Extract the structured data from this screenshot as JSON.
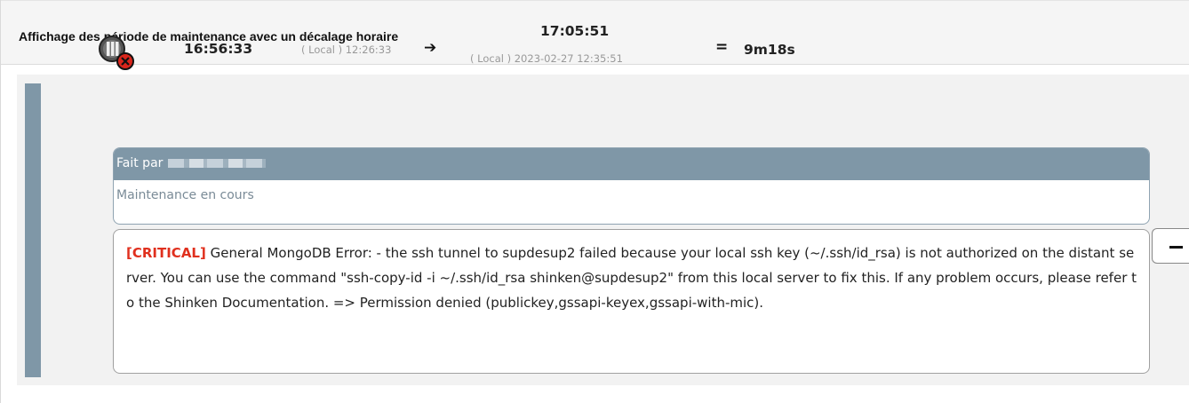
{
  "panel": {
    "title": "Affichage des période de maintenance avec un décalage horaire"
  },
  "maintenance": {
    "status_icon": "maintenance-critical-icon",
    "start_time": "16:56:33",
    "start_local": "( Local ) 12:26:33",
    "arrow_icon": "arrow-right-icon",
    "end_time": "17:05:51",
    "end_local": "( Local ) 2023-02-27 12:35:51",
    "equals": "=",
    "duration": "9m18s",
    "done_by_label": "Fait par",
    "status_text": "Maintenance en cours",
    "output_severity": "[CRITICAL]",
    "output_message": " General MongoDB Error: - the ssh tunnel to supdesup2 failed because your local ssh key (~/.ssh/id_rsa) is not authorized on the distant server. You can use the command \"ssh-copy-id -i ~/.ssh/id_rsa shinken@supdesup2\" from this local server to fix this. If any problem occurs, please refer to the Shinken Documentation. => Permission denied (publickey,gssapi-keyex,gssapi-with-mic).",
    "collapse_icon": "minus-icon"
  },
  "colors": {
    "accent_bar": "#7f97a7",
    "critical": "#e0301e"
  }
}
